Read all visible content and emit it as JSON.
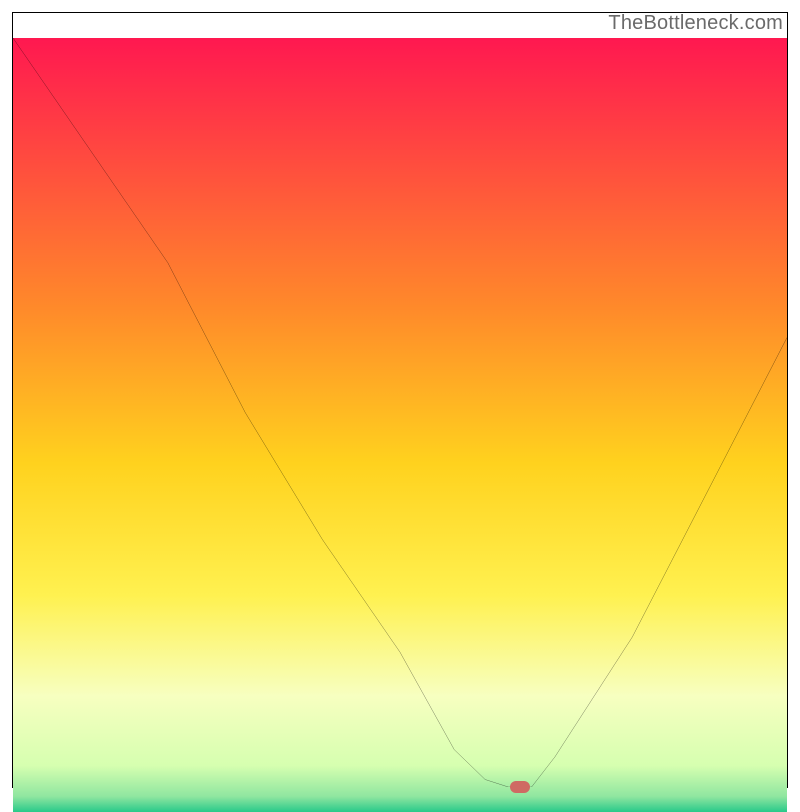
{
  "attribution": "TheBottleneck.com",
  "chart_data": {
    "type": "line",
    "title": "",
    "xlabel": "",
    "ylabel": "",
    "xlim": [
      0,
      100
    ],
    "ylim": [
      0,
      100
    ],
    "x": [
      0,
      10,
      20,
      30,
      40,
      50,
      57,
      61,
      64,
      67,
      70,
      80,
      90,
      100
    ],
    "values": [
      100,
      85,
      70,
      50,
      33,
      18,
      5,
      1,
      0,
      0,
      4,
      20,
      40,
      60
    ],
    "marker": {
      "x": 65.5,
      "y": 0
    },
    "note": "Vertical gradient background from red (top) through yellow to green (bottom). Single black curve with a minimum near x≈65; small rounded marker at the minimum."
  },
  "colors": {
    "gradient_stops": [
      {
        "pos": 0,
        "color": "#ff1850"
      },
      {
        "pos": 0.35,
        "color": "#ff8a2a"
      },
      {
        "pos": 0.55,
        "color": "#ffd21e"
      },
      {
        "pos": 0.72,
        "color": "#fff150"
      },
      {
        "pos": 0.85,
        "color": "#f7ffc0"
      },
      {
        "pos": 0.94,
        "color": "#d6ffb0"
      },
      {
        "pos": 0.98,
        "color": "#8fe6a0"
      },
      {
        "pos": 1.0,
        "color": "#28c98a"
      }
    ],
    "curve": "#000000",
    "marker": "#cf6a63",
    "frame": "#000000"
  }
}
